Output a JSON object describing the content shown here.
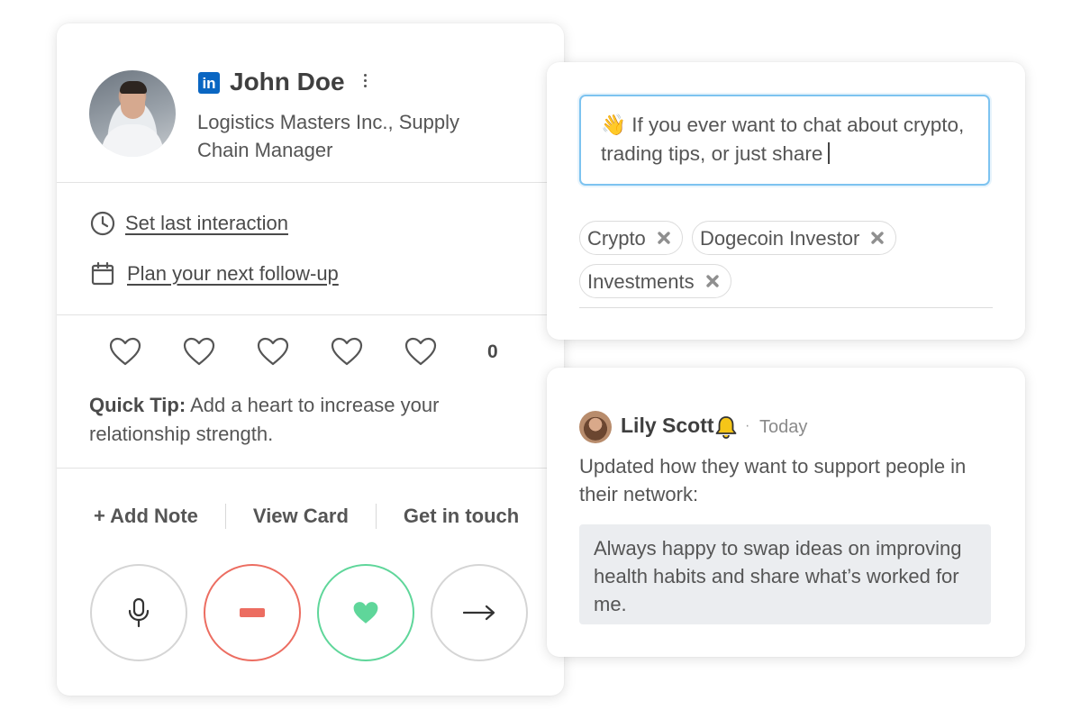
{
  "contact": {
    "linkedin_badge": "in",
    "name": "John Doe",
    "company": "Logistics Masters Inc., Supply Chain Manager",
    "actions": {
      "set_last_interaction": "Set last interaction",
      "plan_follow_up": "Plan your next follow-up"
    },
    "hearts": {
      "filled": 0,
      "total": 5,
      "count_label": "0"
    },
    "quick_tip": {
      "label": "Quick Tip:",
      "text": " Add a heart to increase your relationship strength."
    },
    "tabs": {
      "add_note": "+ Add Note",
      "view_card": "View Card",
      "get_in_touch": "Get in touch"
    },
    "buttons": [
      "microphone-icon",
      "minus-icon",
      "heart-icon",
      "arrow-right-icon"
    ],
    "colors": {
      "linkedin": "#0a66c2",
      "minus": "#ec6d61",
      "heart": "#5fd69a",
      "border": "#d5d5d5"
    }
  },
  "message": {
    "emoji": "👋",
    "text": " If you ever want to chat about crypto, trading tips, or just share",
    "tags": [
      "Crypto",
      "Dogecoin Investor",
      "Investments"
    ],
    "input_border_color": "#7dc3f0"
  },
  "activity": {
    "name": "Lily Scott",
    "bell": "🔔",
    "separator": "·",
    "time": "Today",
    "text": "Updated how they want to support people in their network:",
    "quote": "Always happy to swap ideas on improving health habits and share what’s worked for me.",
    "bell_color": "#f5c518"
  }
}
